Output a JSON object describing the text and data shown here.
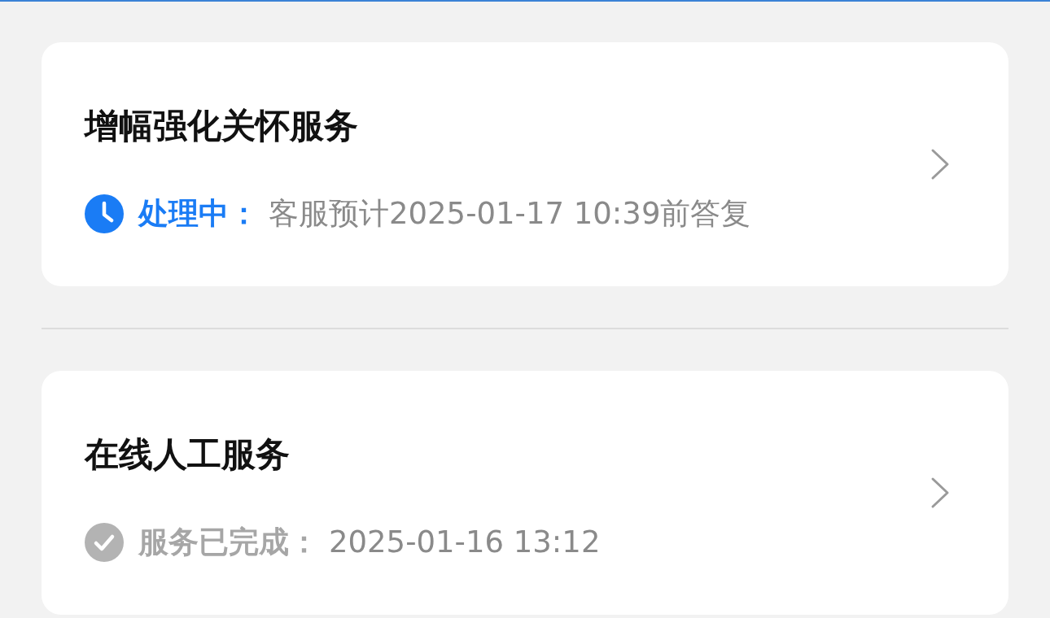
{
  "services": [
    {
      "title": "增幅强化关怀服务",
      "status": {
        "kind": "pending",
        "label": "处理中：",
        "detail": "客服预计2025-01-17 10:39前答复"
      }
    },
    {
      "title": "在线人工服务",
      "status": {
        "kind": "done",
        "label": "服务已完成：",
        "detail": "2025-01-16 13:12"
      }
    }
  ]
}
